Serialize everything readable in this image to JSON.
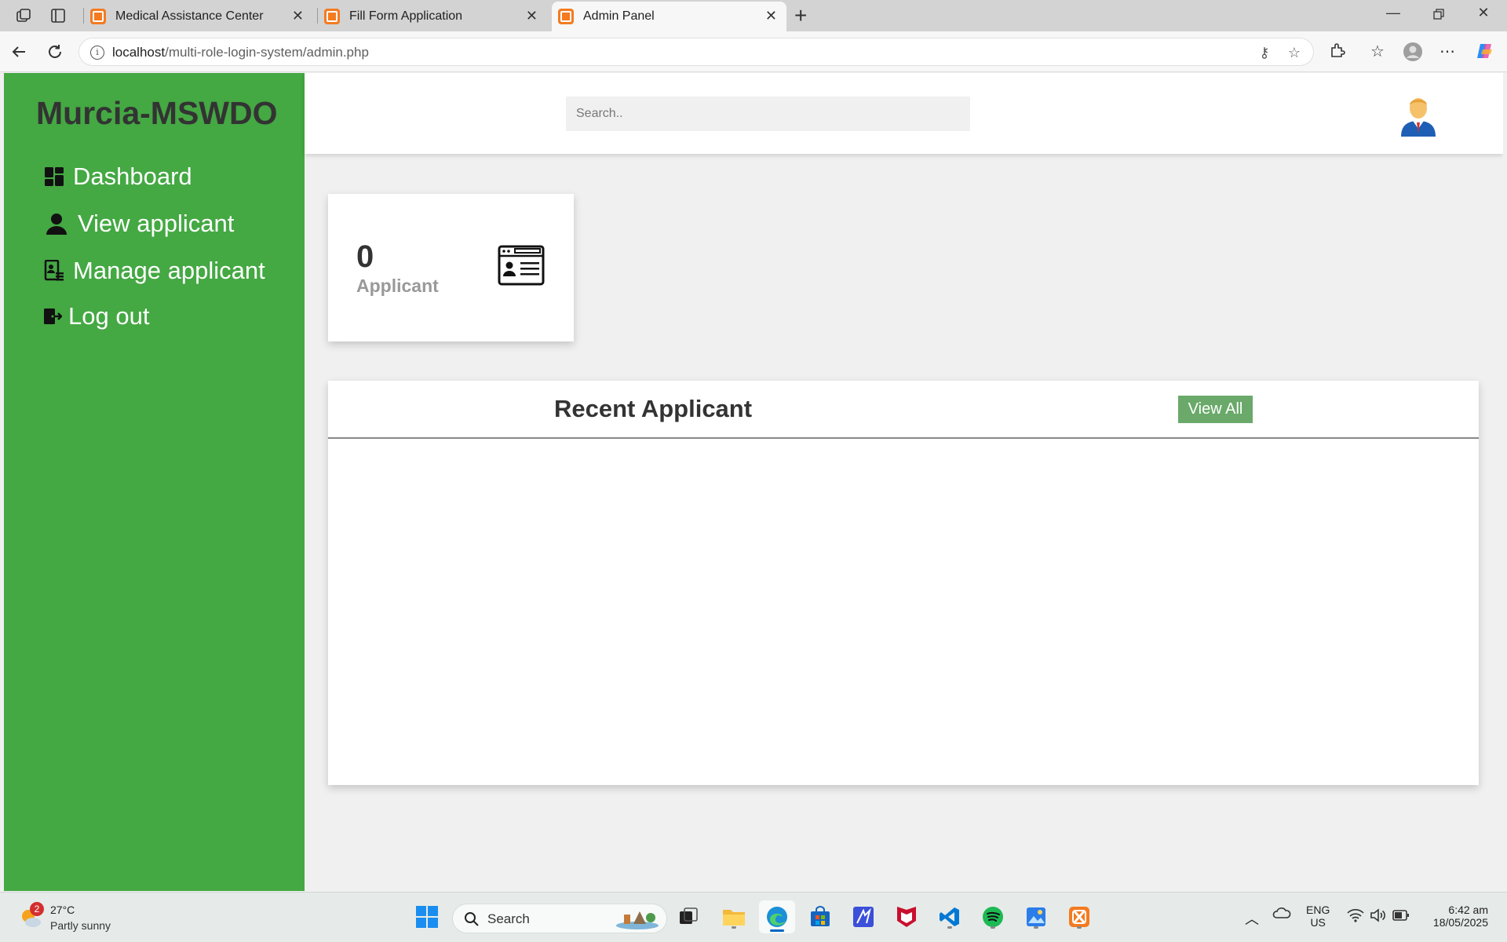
{
  "browser": {
    "tabs": [
      {
        "title": "Medical Assistance Center"
      },
      {
        "title": "Fill Form Application"
      },
      {
        "title": "Admin Panel"
      }
    ],
    "url_host": "localhost",
    "url_path": "/multi-role-login-system/admin.php"
  },
  "sidebar": {
    "brand": "Murcia-MSWDO",
    "items": [
      {
        "label": "Dashboard",
        "icon": "dashboard-icon"
      },
      {
        "label": "View applicant",
        "icon": "user-icon"
      },
      {
        "label": "Manage applicant",
        "icon": "manage-applicant-icon"
      },
      {
        "label": "Log out",
        "icon": "logout-icon"
      }
    ]
  },
  "topbar": {
    "search_placeholder": "Search.."
  },
  "stats": {
    "count": "0",
    "label": "Applicant"
  },
  "recent": {
    "title": "Recent Applicant",
    "view_all": "View All"
  },
  "taskbar": {
    "weather_temp": "27°C",
    "weather_desc": "Partly sunny",
    "weather_badge": "2",
    "search_label": "Search",
    "lang_line1": "ENG",
    "lang_line2": "US",
    "time": "6:42 am",
    "date": "18/05/2025"
  },
  "colors": {
    "sidebar": "#44a843",
    "view_all_button": "#6aa96a",
    "page_background": "#f0f0f0"
  }
}
